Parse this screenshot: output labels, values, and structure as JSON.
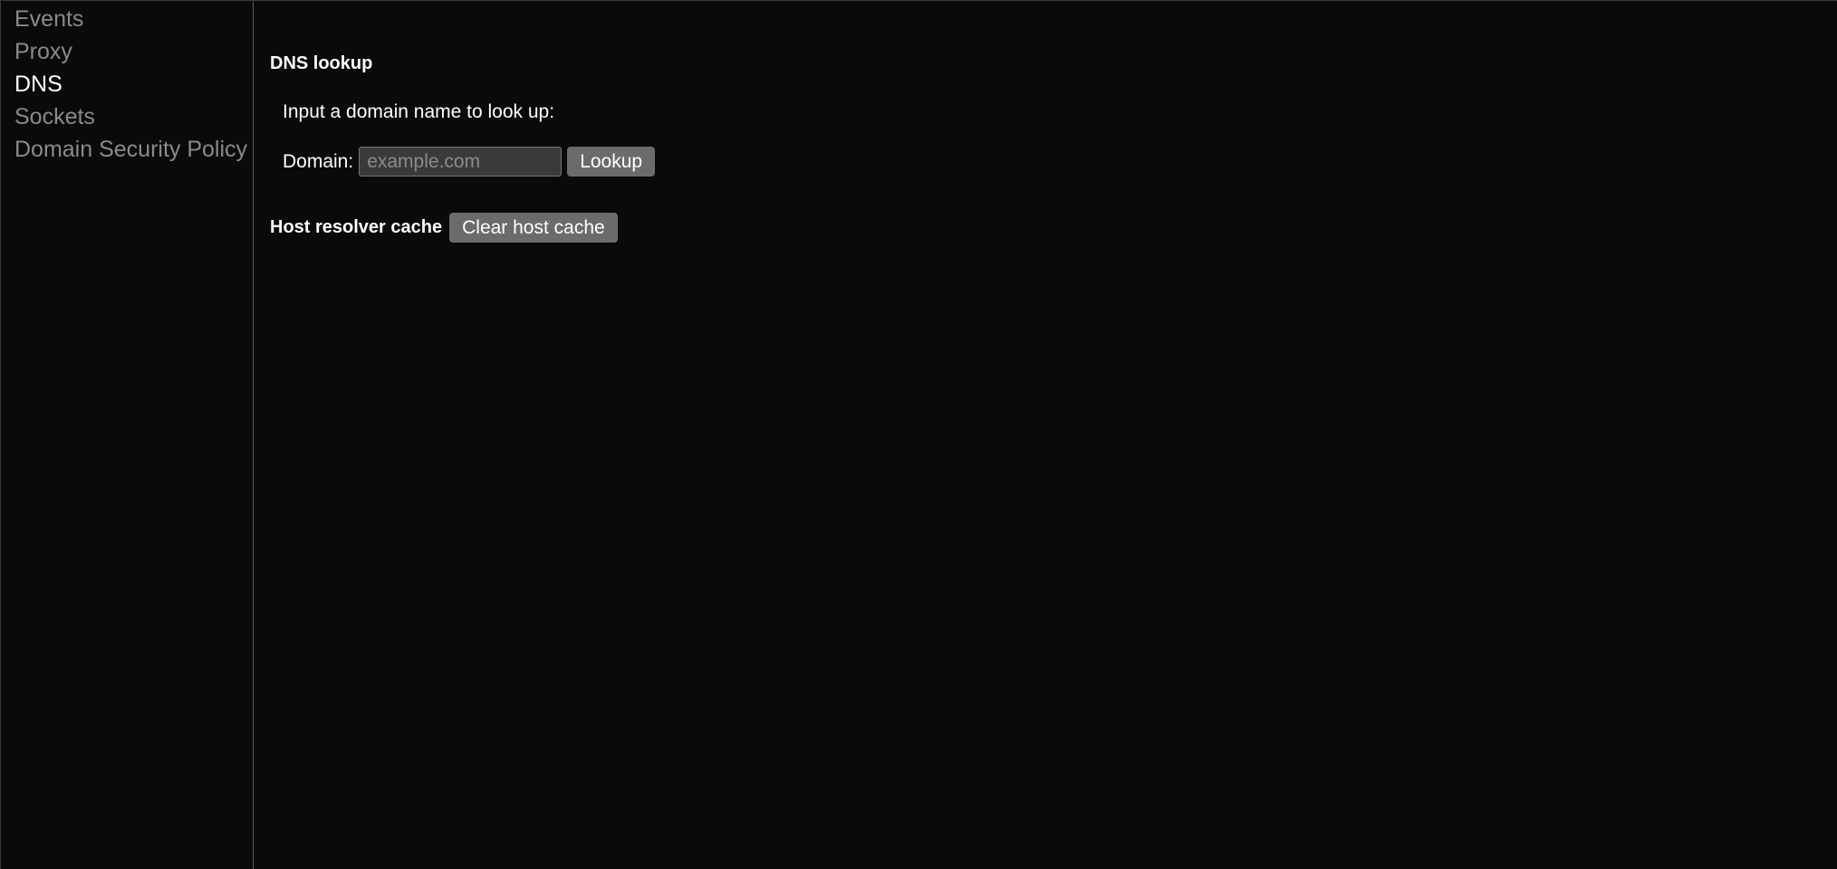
{
  "sidebar": {
    "items": [
      {
        "label": "Events",
        "active": false
      },
      {
        "label": "Proxy",
        "active": false
      },
      {
        "label": "DNS",
        "active": true
      },
      {
        "label": "Sockets",
        "active": false
      },
      {
        "label": "Domain Security Policy",
        "active": false
      }
    ]
  },
  "main": {
    "dns_lookup": {
      "title": "DNS lookup",
      "instruction": "Input a domain name to look up:",
      "domain_label": "Domain:",
      "domain_placeholder": "example.com",
      "domain_value": "",
      "lookup_button": "Lookup"
    },
    "host_cache": {
      "label": "Host resolver cache",
      "clear_button": "Clear host cache"
    }
  }
}
